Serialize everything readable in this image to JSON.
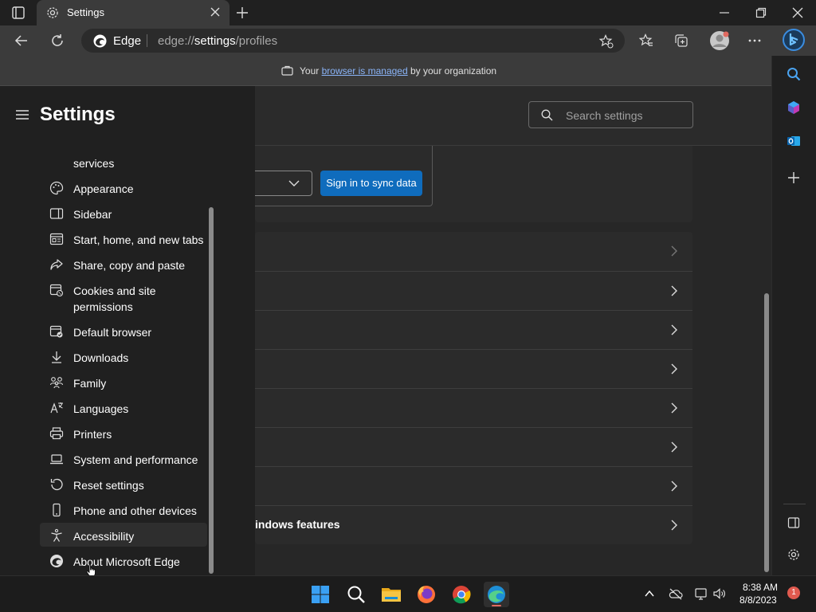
{
  "browser": {
    "tab_title": "Settings",
    "address_label": "Edge",
    "address_prefix": "edge://",
    "address_bold": "settings",
    "address_suffix": "/profiles"
  },
  "managed_bar": {
    "prefix": "Your ",
    "link": "browser is managed",
    "suffix": " by your organization"
  },
  "settings": {
    "title": "Settings",
    "search_placeholder": "Search settings",
    "sync_button": "Sign in to sync data",
    "nav_items": [
      {
        "label": "services",
        "icon": "services"
      },
      {
        "label": "Appearance",
        "icon": "palette-icon"
      },
      {
        "label": "Sidebar",
        "icon": "sidebar-icon"
      },
      {
        "label": "Start, home, and new tabs",
        "icon": "home-icon"
      },
      {
        "label": "Share, copy and paste",
        "icon": "share-icon"
      },
      {
        "label": "Cookies and site",
        "label2": "permissions",
        "icon": "cookies-icon"
      },
      {
        "label": "Default browser",
        "icon": "default-browser-icon"
      },
      {
        "label": "Downloads",
        "icon": "download-icon"
      },
      {
        "label": "Family",
        "icon": "family-icon"
      },
      {
        "label": "Languages",
        "icon": "languages-icon"
      },
      {
        "label": "Printers",
        "icon": "printer-icon"
      },
      {
        "label": "System and performance",
        "icon": "laptop-icon"
      },
      {
        "label": "Reset settings",
        "icon": "reset-icon"
      },
      {
        "label": "Phone and other devices",
        "icon": "phone-icon"
      },
      {
        "label": "Accessibility",
        "icon": "accessibility-icon"
      },
      {
        "label": "About Microsoft Edge",
        "icon": "edge-icon"
      }
    ],
    "list_rows": [
      "",
      "",
      "",
      "",
      "",
      "",
      "",
      "indows features"
    ]
  },
  "taskbar": {
    "time": "8:38 AM",
    "date": "8/8/2023",
    "notification_count": "1"
  },
  "colors": {
    "accent": "#0f6cbd",
    "link": "#8ab4f8",
    "background": "#202020"
  }
}
